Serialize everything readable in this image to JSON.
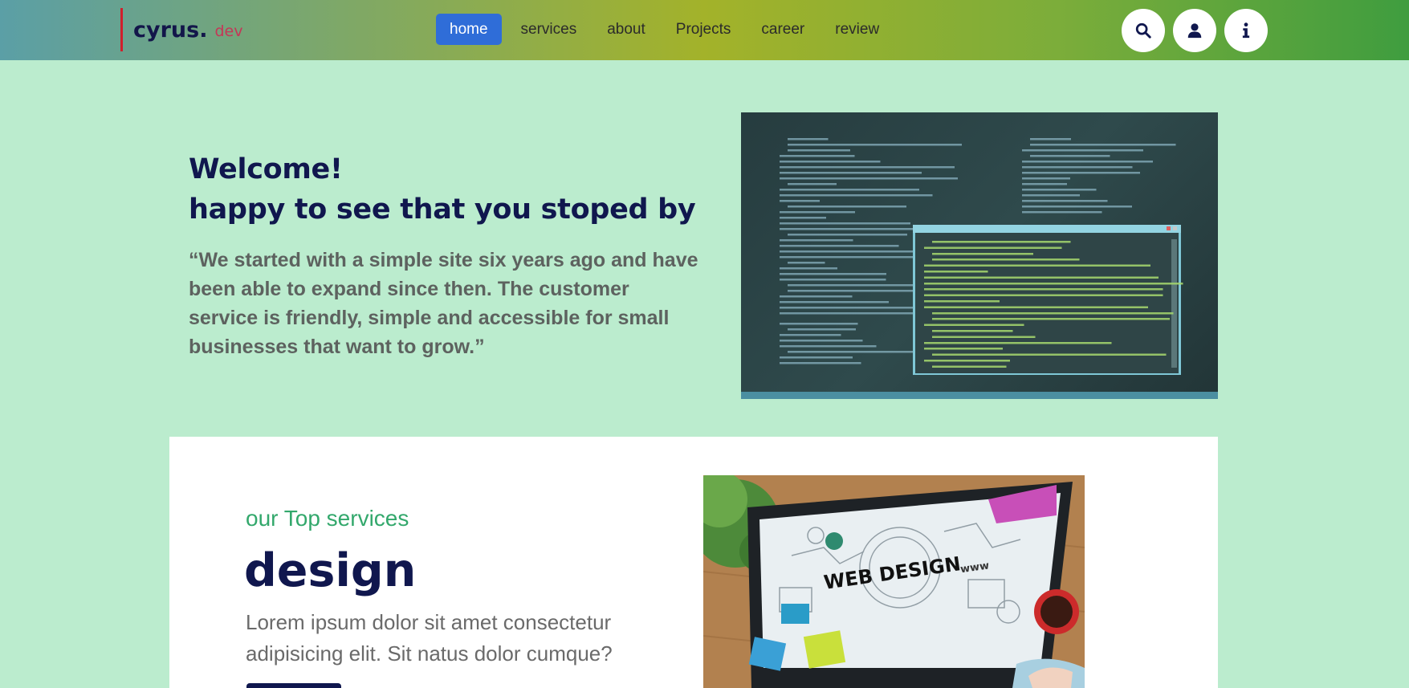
{
  "header": {
    "logo_main": "cyrus.",
    "logo_sub": "dev",
    "nav": [
      {
        "label": "home",
        "active": true
      },
      {
        "label": "services",
        "active": false
      },
      {
        "label": "about",
        "active": false
      },
      {
        "label": "Projects",
        "active": false
      },
      {
        "label": "career",
        "active": false
      },
      {
        "label": "review",
        "active": false
      }
    ],
    "icons": [
      "search-icon",
      "user-icon",
      "info-icon"
    ]
  },
  "hero": {
    "title_line1": "Welcome!",
    "title_line2": "happy to see that you stoped by",
    "quote": "“We started with a simple site six years ago and have been able to expand since then. The customer service is friendly, simple and accessible for small businesses that want to grow.”"
  },
  "services": {
    "subtitle": "our Top services",
    "title": "design",
    "text": "Lorem ipsum dolor sit amet consectetur adipisicing elit. Sit natus dolor cumque?",
    "image_text": "WEB DESIGN",
    "image_text_small": "www"
  },
  "colors": {
    "accent": "#2f6dd8",
    "navy": "#10174e",
    "green": "#33a86c",
    "background": "#bbecce"
  }
}
